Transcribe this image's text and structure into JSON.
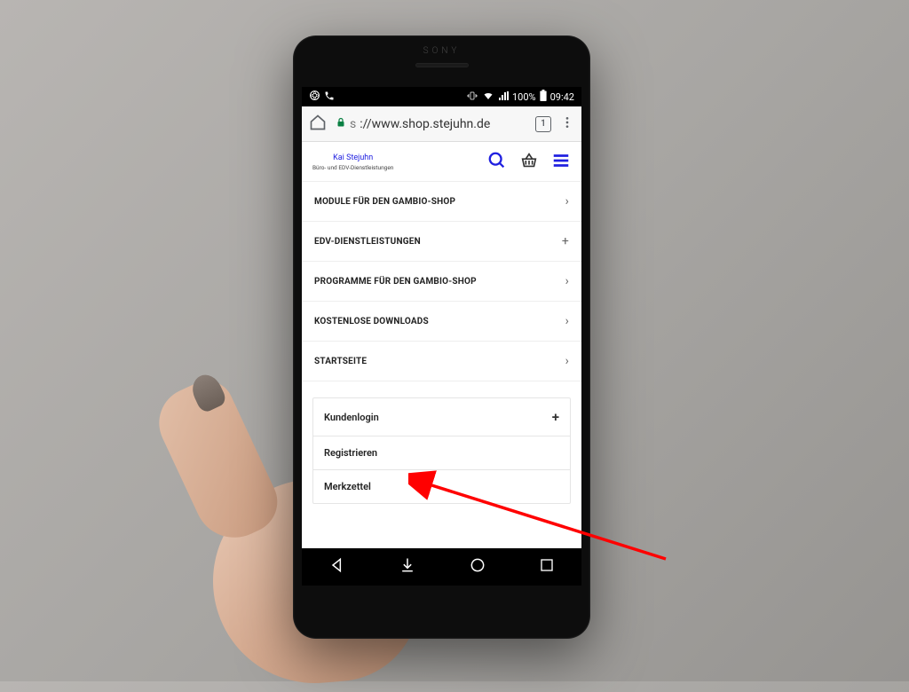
{
  "phone": {
    "brand": "SONY"
  },
  "status_bar": {
    "battery_pct": "100%",
    "time": "09:42"
  },
  "browser": {
    "url_display": "://www.shop.stejuhn.de",
    "url_prefix": "s",
    "tab_count": "1"
  },
  "shop": {
    "logo_name": "Kai Stejuhn",
    "logo_sub": "Büro- und EDV-Dienstleistungen"
  },
  "menu": [
    {
      "label": "MODULE FÜR DEN GAMBIO-SHOP",
      "icon": "chevron"
    },
    {
      "label": "EDV-DIENSTLEISTUNGEN",
      "icon": "plus"
    },
    {
      "label": "PROGRAMME FÜR DEN GAMBIO-SHOP",
      "icon": "chevron"
    },
    {
      "label": "KOSTENLOSE DOWNLOADS",
      "icon": "chevron"
    },
    {
      "label": "STARTSEITE",
      "icon": "chevron"
    }
  ],
  "account": {
    "login": {
      "label": "Kundenlogin",
      "icon": "plus"
    },
    "register": {
      "label": "Registrieren"
    },
    "wishlist": {
      "label": "Merkzettel"
    }
  }
}
